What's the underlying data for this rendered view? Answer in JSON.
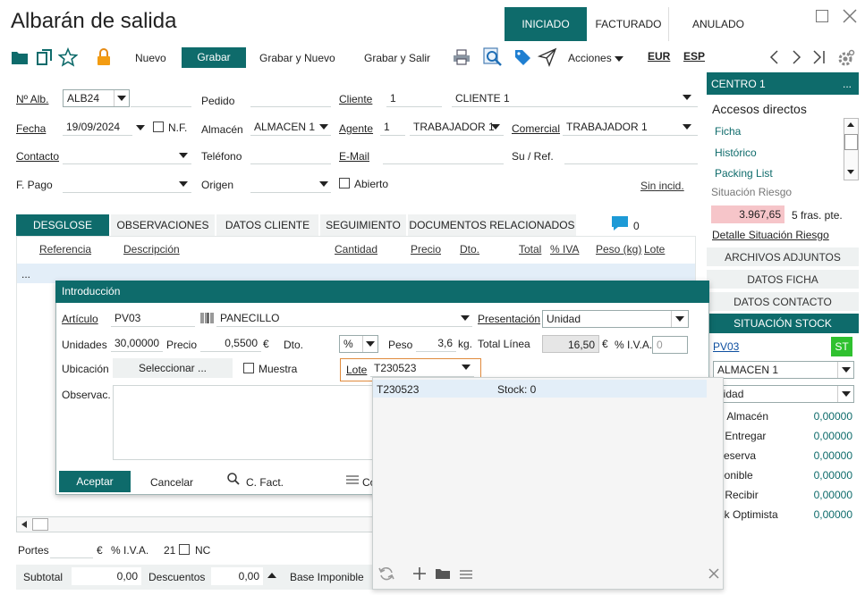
{
  "window": {
    "title": "Albarán de salida",
    "status_tabs": [
      "INICIADO",
      "FACTURADO",
      "ANULADO"
    ],
    "active_status": "INICIADO"
  },
  "toolbar": {
    "nuevo": "Nuevo",
    "grabar": "Grabar",
    "grabar_nuevo": "Grabar y Nuevo",
    "grabar_salir": "Grabar y Salir",
    "acciones": "Acciones",
    "currency": "EUR",
    "language": "ESP"
  },
  "header": {
    "n_alb_label": "Nº Alb.",
    "n_alb_value": "ALB24",
    "pedido_label": "Pedido",
    "cliente_label": "Cliente",
    "cliente_code": "1",
    "cliente_name": "CLIENTE 1",
    "fecha_label": "Fecha",
    "fecha_value": "19/09/2024",
    "nf_label": "N.F.",
    "almacen_label": "Almacén",
    "almacen_value": "ALMACEN 1",
    "agente_label": "Agente",
    "agente_code": "1",
    "agente_name": "TRABAJADOR 1",
    "comercial_label": "Comercial",
    "comercial_value": "TRABAJADOR 1",
    "contacto_label": "Contacto",
    "telefono_label": "Teléfono",
    "email_label": "E-Mail",
    "suref_label": "Su / Ref.",
    "fpago_label": "F. Pago",
    "origen_label": "Origen",
    "abierto_label": "Abierto",
    "sin_incid": "Sin incid."
  },
  "tabs": [
    "DESGLOSE",
    "OBSERVACIONES",
    "DATOS CLIENTE",
    "SEGUIMIENTO",
    "DOCUMENTOS RELACIONADOS"
  ],
  "comments_count": "0",
  "grid_headers": [
    "Referencia",
    "Descripción",
    "Cantidad",
    "Precio",
    "Dto.",
    "Total",
    "% IVA",
    "Peso (kg)",
    "Lote"
  ],
  "grid_row_marker": "...",
  "dialog": {
    "title": "Introducción",
    "articulo_label": "Artículo",
    "articulo_code": "PV03",
    "articulo_name": "PANECILLO",
    "presentacion_label": "Presentación",
    "presentacion_value": "Unidad",
    "unidades_label": "Unidades",
    "unidades_value": "30,00000",
    "precio_label": "Precio",
    "precio_value": "0,5500",
    "precio_currency": "€",
    "dto_label": "Dto.",
    "dto_type": "%",
    "peso_label": "Peso",
    "peso_value": "3,6",
    "peso_unit": "kg.",
    "total_linea_label": "Total Línea",
    "total_linea_value": "16,50",
    "total_currency": "€",
    "iva_label": "% I.V.A.",
    "iva_value": "0",
    "ubicacion_label": "Ubicación",
    "seleccionar": "Seleccionar ...",
    "muestra_label": "Muestra",
    "lote_label": "Lote",
    "lote_value": "T230523",
    "observac_label": "Observac.",
    "aceptar": "Aceptar",
    "cancelar": "Cancelar",
    "cfact": "C. Fact.",
    "cut_label": "Co"
  },
  "lote_dropdown": {
    "rows": [
      {
        "lote": "T230523",
        "stock": "Stock: 0"
      }
    ]
  },
  "footer": {
    "portes_label": "Portes",
    "portes_currency": "€",
    "iva_label": "% I.V.A.",
    "iva_value": "21",
    "nc_label": "NC",
    "subtotal_label": "Subtotal",
    "subtotal_value": "0,00",
    "descuentos_label": "Descuentos",
    "descuentos_value": "0,00",
    "base_label": "Base Imponible"
  },
  "sidebar": {
    "centro": "CENTRO 1",
    "centro_more": "...",
    "accesos": "Accesos directos",
    "links": [
      "Ficha",
      "Histórico",
      "Packing List"
    ],
    "riesgo_label": "Situación Riesgo",
    "riesgo_value": "3.967,65",
    "riesgo_fras": "5 fras. pte.",
    "detalle": "Detalle Situación Riesgo",
    "buttons": [
      "ARCHIVOS ADJUNTOS",
      "DATOS FICHA",
      "DATOS CONTACTO"
    ],
    "stock_title": "SITUACIÓN STOCK",
    "stock_article": "PV03",
    "stock_badge": "ST",
    "stock_almacen": "ALMACEN 1",
    "stock_unidad": "nidad",
    "stock_rows": [
      {
        "label": "tal Almacén",
        "value": "0,00000"
      },
      {
        "label": "e. Entregar",
        "value": "0,00000"
      },
      {
        "label": "reserva",
        "value": "0,00000"
      },
      {
        "label": "sponible",
        "value": "0,00000"
      },
      {
        "label": "e. Recibir",
        "value": "0,00000"
      },
      {
        "label": "ock Optimista",
        "value": "0,00000"
      }
    ]
  },
  "colors": {
    "teal": "#0e6b6b",
    "green": "#2fc12f",
    "risk_bg": "#f6c5c9",
    "highlight": "#e3eef8",
    "orange": "#e08a3c"
  }
}
